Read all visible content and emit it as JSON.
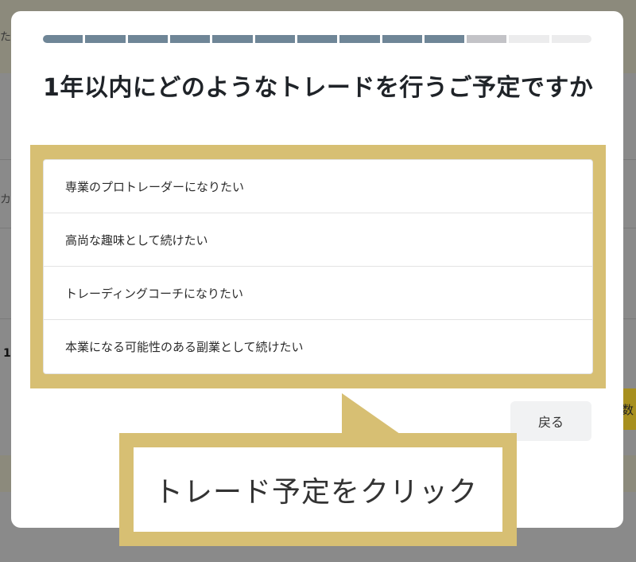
{
  "modal": {
    "title": "1年以内にどのようなトレードを行うご予定ですか",
    "progress": {
      "total_steps": 13,
      "completed_steps": 10,
      "current_step": 11
    },
    "options": [
      {
        "label": "専業のプロトレーダーになりたい"
      },
      {
        "label": "高尚な趣味として続けたい"
      },
      {
        "label": "トレーディングコーチになりたい"
      },
      {
        "label": "本業になる可能性のある副業として続けたい"
      }
    ],
    "back_label": "戻る"
  },
  "annotation": {
    "callout_text": "トレード予定をクリック"
  },
  "background": {
    "left_text_1": "た",
    "left_text_2": "カ",
    "left_text_3": "1",
    "right_btn_text": "数"
  },
  "colors": {
    "progress_done": "#6f8697",
    "progress_current": "#c3c3c7",
    "progress_todo": "#ececed",
    "highlight": "#d7bf73"
  }
}
